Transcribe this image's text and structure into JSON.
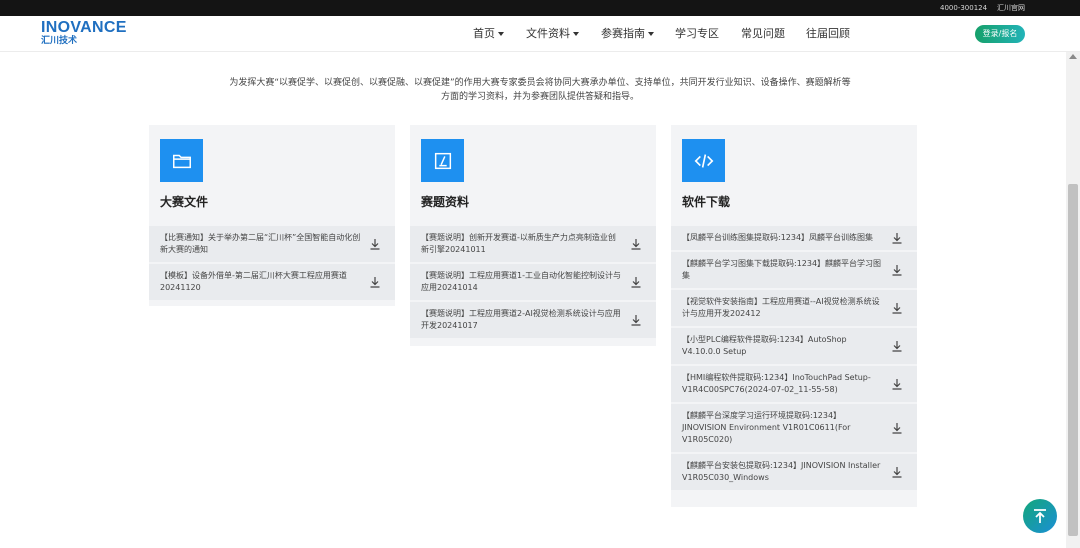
{
  "topbar": {
    "phone": "4000-300124",
    "official_site": "汇川官网"
  },
  "logo": {
    "brand": "INOVANCE",
    "sub": "汇川技术"
  },
  "menu": [
    {
      "label": "首页",
      "dropdown": true
    },
    {
      "label": "文件资料",
      "dropdown": true
    },
    {
      "label": "参赛指南",
      "dropdown": true
    },
    {
      "label": "学习专区",
      "dropdown": false
    },
    {
      "label": "常见问题",
      "dropdown": false
    },
    {
      "label": "往届回顾",
      "dropdown": false
    }
  ],
  "login_label": "登录/报名",
  "intro": {
    "line1": "为发挥大赛“以赛促学、以赛促创、以赛促融、以赛促建”的作用大赛专家委员会将协同大赛承办单位、支持单位，共同开发行业知识、设备操作、赛题解析等",
    "line2": "方面的学习资料，并为参赛团队提供答疑和指导。"
  },
  "cards": [
    {
      "title": "大赛文件",
      "icon": "folder-icon",
      "items": [
        "【比赛通知】关于举办第二届“汇川杯”全国智能自动化创新大赛的通知",
        "【模板】设备外借单-第二届汇川杯大赛工程应用赛道20241120"
      ]
    },
    {
      "title": "赛题资料",
      "icon": "edit-icon",
      "items": [
        "【赛题说明】创新开发赛道-以新质生产力点亮制造业创新引擎20241011",
        "【赛题说明】工程应用赛道1-工业自动化智能控制设计与应用20241014",
        "【赛题说明】工程应用赛道2-AI视觉检测系统设计与应用开发20241017"
      ]
    },
    {
      "title": "软件下载",
      "icon": "code-icon",
      "items": [
        "【凤麟平台训练图集提取码:1234】凤麟平台训练图集",
        "【麒麟平台学习图集下载提取码:1234】麒麟平台学习图集",
        "【视觉软件安装指南】工程应用赛道--AI视觉检测系统设计与应用开发202412",
        "【小型PLC编程软件提取码:1234】AutoShop V4.10.0.0 Setup",
        "【HMI编程软件提取码:1234】InoTouchPad Setup-V1R4C00SPC76(2024-07-02_11-55-58)",
        "【麒麟平台深度学习运行环境提取码:1234】JINOVISION Environment V1R01C0611(For V1R05C020)",
        "【麒麟平台安装包提取码:1234】JINOVISION Installer V1R05C030_Windows"
      ]
    }
  ],
  "colors": {
    "brand": "#1f6fc0",
    "icon_bg": "#1e90f0",
    "login_grad_start": "#16a06a",
    "login_grad_end": "#22b3b8"
  }
}
